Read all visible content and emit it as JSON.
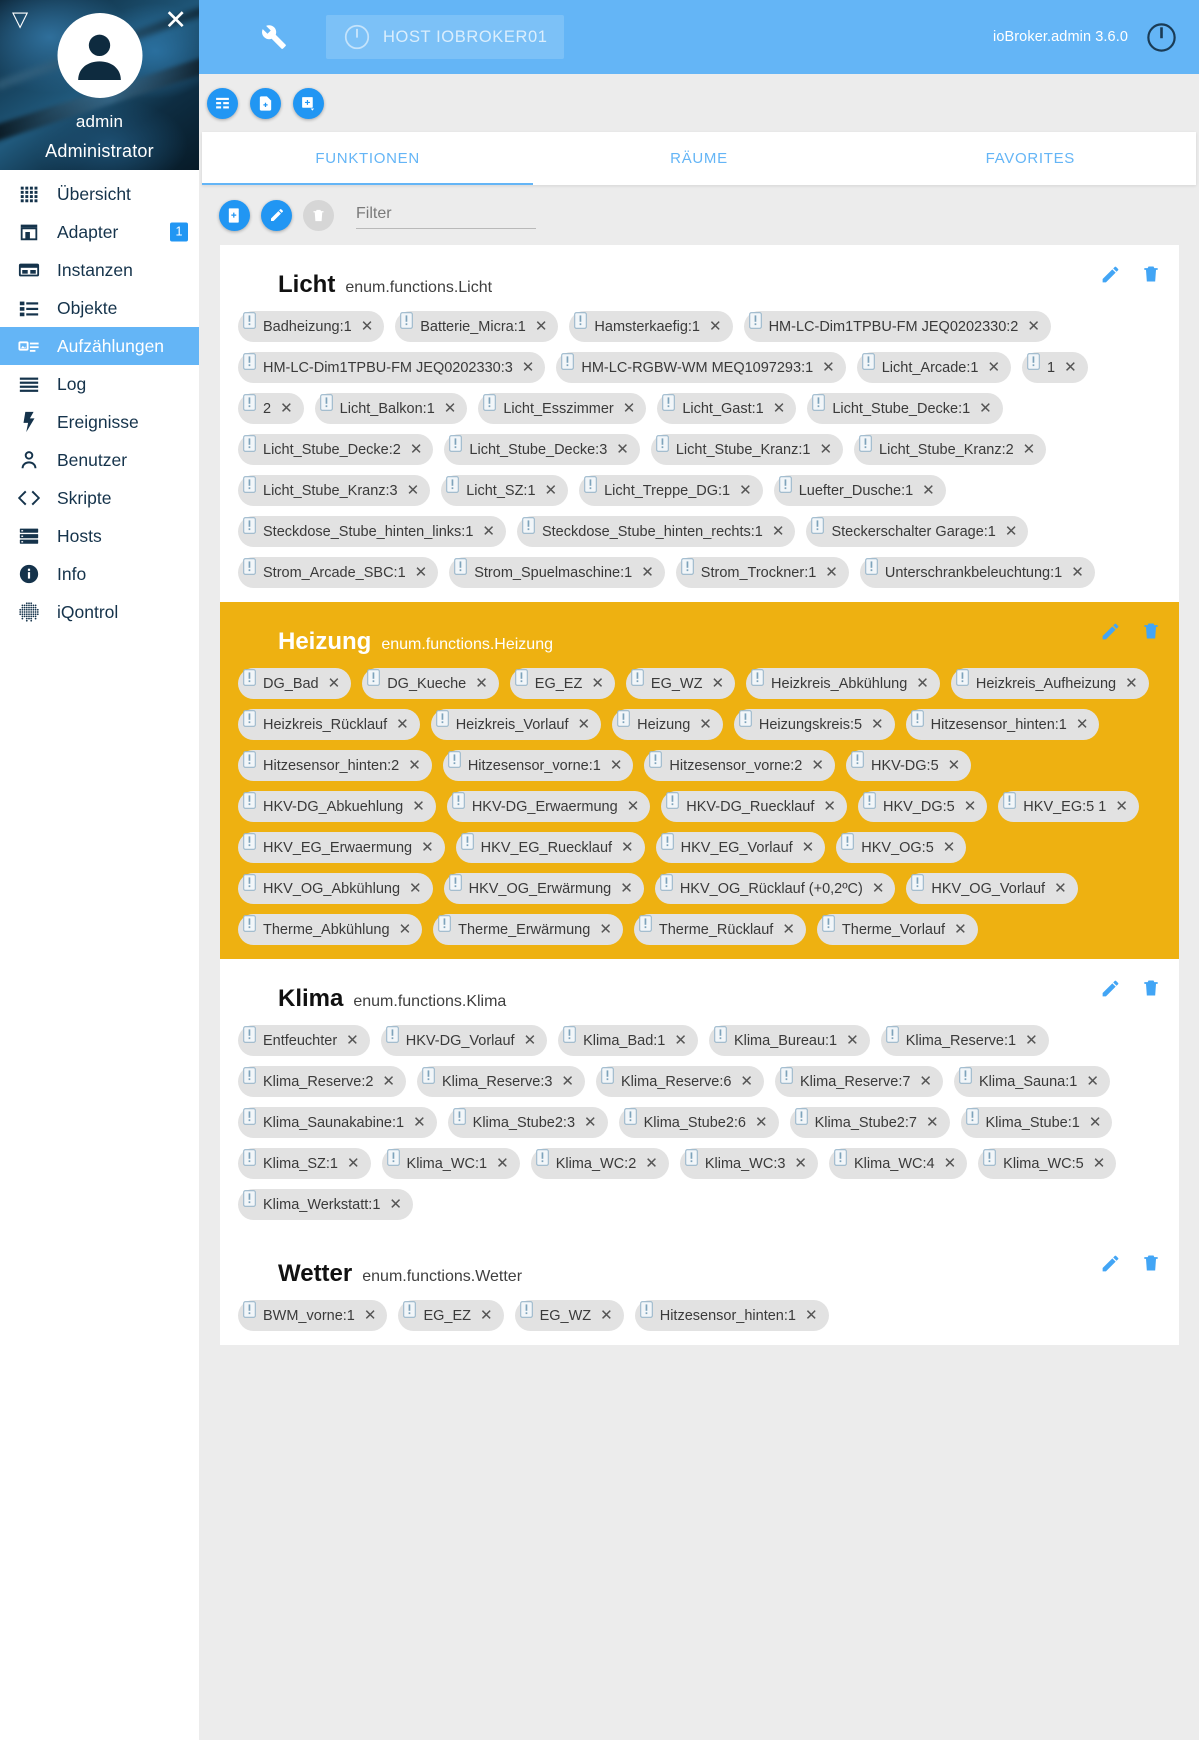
{
  "sidebar": {
    "menu_arrow_icon": "triangle-down-icon",
    "close_icon": "close-icon",
    "avatar_icon": "user-avatar-icon",
    "username": "admin",
    "role": "Administrator",
    "items": [
      {
        "label": "Übersicht",
        "icon": "grid-dots-icon",
        "badge": null,
        "active": false
      },
      {
        "label": "Adapter",
        "icon": "store-icon",
        "badge": "1",
        "active": false
      },
      {
        "label": "Instanzen",
        "icon": "instances-icon",
        "badge": null,
        "active": false
      },
      {
        "label": "Objekte",
        "icon": "list-icon",
        "badge": null,
        "active": false
      },
      {
        "label": "Aufzählungen",
        "icon": "enums-icon",
        "badge": null,
        "active": true
      },
      {
        "label": "Log",
        "icon": "lines-icon",
        "badge": null,
        "active": false
      },
      {
        "label": "Ereignisse",
        "icon": "bolt-icon",
        "badge": null,
        "active": false
      },
      {
        "label": "Benutzer",
        "icon": "person-icon",
        "badge": null,
        "active": false
      },
      {
        "label": "Skripte",
        "icon": "code-icon",
        "badge": null,
        "active": false
      },
      {
        "label": "Hosts",
        "icon": "server-icon",
        "badge": null,
        "active": false
      },
      {
        "label": "Info",
        "icon": "info-icon",
        "badge": null,
        "active": false
      },
      {
        "label": "iQontrol",
        "icon": "dots-matrix-icon",
        "badge": null,
        "active": false
      }
    ]
  },
  "appbar": {
    "wrench_icon": "wrench-icon",
    "host_power_icon": "power-icon",
    "host_label": "HOST IOBROKER01",
    "version": "ioBroker.admin 3.6.0",
    "power_icon": "power-icon"
  },
  "toolbar": {
    "buttons": [
      {
        "icon": "list-add-icon"
      },
      {
        "icon": "file-add-icon"
      },
      {
        "icon": "import-icon"
      }
    ]
  },
  "tabs": [
    {
      "label": "FUNKTIONEN",
      "active": true
    },
    {
      "label": "RÄUME",
      "active": false
    },
    {
      "label": "FAVORITES",
      "active": false
    }
  ],
  "filterbar": {
    "add_icon": "add-enum-icon",
    "edit_icon": "pencil-icon",
    "delete_icon": "trash-icon",
    "filter_placeholder": "Filter",
    "filter_value": ""
  },
  "colors": {
    "appbar": "#64b5f6",
    "accent": "#2196f3",
    "amber_card": "#eeb111",
    "sidebar_active": "#64b5f6",
    "chip_bg": "#e2e2e2",
    "page_bg": "#ececec"
  },
  "cards": [
    {
      "title": "Licht",
      "id": "enum.functions.Licht",
      "color": "white",
      "edit_icon": "pencil-icon",
      "delete_icon": "trash-icon",
      "members": [
        "Badheizung:1",
        "Batterie_Micra:1",
        "Hamsterkaefig:1",
        "HM-LC-Dim1TPBU-FM JEQ0202330:2",
        "HM-LC-Dim1TPBU-FM JEQ0202330:3",
        "HM-LC-RGBW-WM MEQ1097293:1",
        "Licht_Arcade:1",
        "1",
        "2",
        "Licht_Balkon:1",
        "Licht_Esszimmer",
        "Licht_Gast:1",
        "Licht_Stube_Decke:1",
        "Licht_Stube_Decke:2",
        "Licht_Stube_Decke:3",
        "Licht_Stube_Kranz:1",
        "Licht_Stube_Kranz:2",
        "Licht_Stube_Kranz:3",
        "Licht_SZ:1",
        "Licht_Treppe_DG:1",
        "Luefter_Dusche:1",
        "Steckdose_Stube_hinten_links:1",
        "Steckdose_Stube_hinten_rechts:1",
        "Steckerschalter Garage:1",
        "Strom_Arcade_SBC:1",
        "Strom_Spuelmaschine:1",
        "Strom_Trockner:1",
        "Unterschrankbeleuchtung:1"
      ]
    },
    {
      "title": "Heizung",
      "id": "enum.functions.Heizung",
      "color": "amber",
      "edit_icon": "pencil-icon",
      "delete_icon": "trash-icon",
      "members": [
        "DG_Bad",
        "DG_Kueche",
        "EG_EZ",
        "EG_WZ",
        "Heizkreis_Abkühlung",
        "Heizkreis_Aufheizung",
        "Heizkreis_Rücklauf",
        "Heizkreis_Vorlauf",
        "Heizung",
        "Heizungskreis:5",
        "Hitzesensor_hinten:1",
        "Hitzesensor_hinten:2",
        "Hitzesensor_vorne:1",
        "Hitzesensor_vorne:2",
        "HKV-DG:5",
        "HKV-DG_Abkuehlung",
        "HKV-DG_Erwaermung",
        "HKV-DG_Ruecklauf",
        "HKV_DG:5",
        "HKV_EG:5 1",
        "HKV_EG_Erwaermung",
        "HKV_EG_Ruecklauf",
        "HKV_EG_Vorlauf",
        "HKV_OG:5",
        "HKV_OG_Abkühlung",
        "HKV_OG_Erwärmung",
        "HKV_OG_Rücklauf (+0,2ºC)",
        "HKV_OG_Vorlauf",
        "Therme_Abkühlung",
        "Therme_Erwärmung",
        "Therme_Rücklauf",
        "Therme_Vorlauf"
      ]
    },
    {
      "title": "Klima",
      "id": "enum.functions.Klima",
      "color": "white",
      "edit_icon": "pencil-icon",
      "delete_icon": "trash-icon",
      "members": [
        "Entfeuchter",
        "HKV-DG_Vorlauf",
        "Klima_Bad:1",
        "Klima_Bureau:1",
        "Klima_Reserve:1",
        "Klima_Reserve:2",
        "Klima_Reserve:3",
        "Klima_Reserve:6",
        "Klima_Reserve:7",
        "Klima_Sauna:1",
        "Klima_Saunakabine:1",
        "Klima_Stube2:3",
        "Klima_Stube2:6",
        "Klima_Stube2:7",
        "Klima_Stube:1",
        "Klima_SZ:1",
        "Klima_WC:1",
        "Klima_WC:2",
        "Klima_WC:3",
        "Klima_WC:4",
        "Klima_WC:5",
        "Klima_Werkstatt:1"
      ]
    },
    {
      "title": "Wetter",
      "id": "enum.functions.Wetter",
      "color": "white",
      "edit_icon": "pencil-icon",
      "delete_icon": "trash-icon",
      "members": [
        "BWM_vorne:1",
        "EG_EZ",
        "EG_WZ",
        "Hitzesensor_hinten:1"
      ]
    }
  ]
}
